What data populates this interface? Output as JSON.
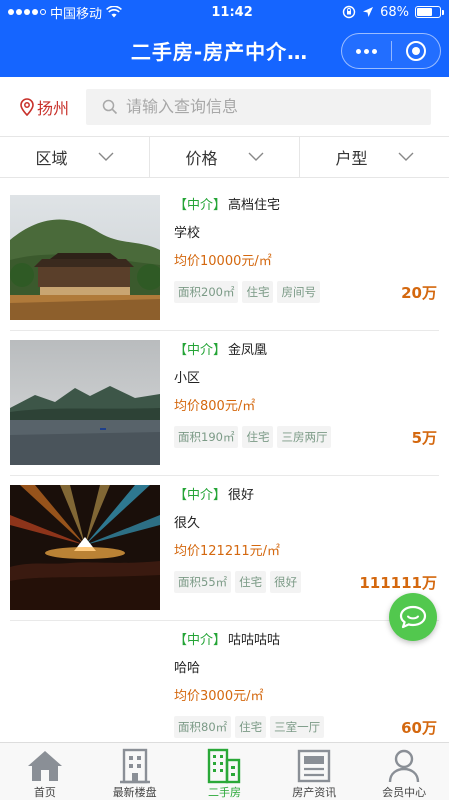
{
  "status_bar": {
    "carrier": "中国移动",
    "time": "11:42",
    "battery": "68%",
    "battery_level": 0.68
  },
  "nav": {
    "title": "二手房-房产中介…"
  },
  "search": {
    "city": "扬州",
    "placeholder": "请输入查询信息"
  },
  "filters": [
    "区域",
    "价格",
    "户型"
  ],
  "listings": [
    {
      "agent_tag": "【中介】",
      "title": "高档住宅",
      "subtitle": "学校",
      "avg_price": "均价10000元/㎡",
      "chips": [
        "面积200㎡",
        "住宅",
        "房间号"
      ],
      "price": "20万"
    },
    {
      "agent_tag": "【中介】",
      "title": "金凤凰",
      "subtitle": "小区",
      "avg_price": "均价800元/㎡",
      "chips": [
        "面积190㎡",
        "住宅",
        "三房两厅"
      ],
      "price": "5万"
    },
    {
      "agent_tag": "【中介】",
      "title": "很好",
      "subtitle": "很久",
      "avg_price": "均价121211元/㎡",
      "chips": [
        "面积55㎡",
        "住宅",
        "很好"
      ],
      "price": "111111万"
    },
    {
      "agent_tag": "【中介】",
      "title": "咕咕咕咕",
      "subtitle": "哈哈",
      "avg_price": "均价3000元/㎡",
      "chips": [
        "面积80㎡",
        "住宅",
        "三室一厅"
      ],
      "price": "60万"
    }
  ],
  "tabs": [
    {
      "label": "首页",
      "icon": "home-icon"
    },
    {
      "label": "最新楼盘",
      "icon": "building-icon"
    },
    {
      "label": "二手房",
      "icon": "apartment-icon",
      "active": true
    },
    {
      "label": "房产资讯",
      "icon": "newspaper-icon"
    },
    {
      "label": "会员中心",
      "icon": "user-icon"
    }
  ],
  "colors": {
    "primary": "#1565ff",
    "agent_green": "#24a436",
    "price_orange": "#d4680f",
    "city_red": "#c8312b",
    "fab_green": "#52c84e"
  }
}
